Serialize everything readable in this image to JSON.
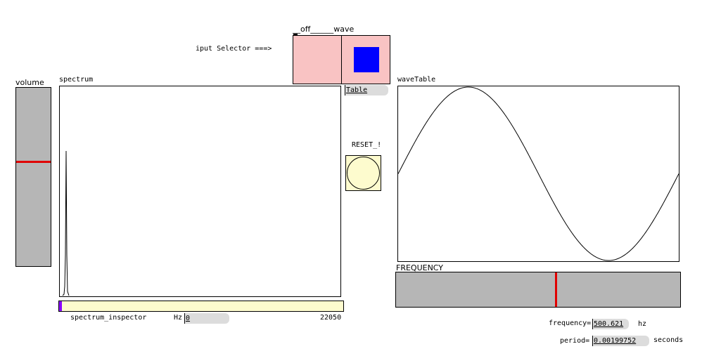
{
  "input_selector": {
    "title": "__off______wave",
    "label": "iput Selector ===>",
    "value_label": "Table",
    "off_color": "#f9c3c3",
    "marker_color": "#0000ff"
  },
  "volume": {
    "label": "volume",
    "level": 0.415,
    "color": "#b6b6b6",
    "indicator_color": "#e00000"
  },
  "spectrum": {
    "label": "spectrum",
    "inspector_label": "spectrum_inspector",
    "hz_label": "Hz",
    "hz_value": "0",
    "max_value": "22050",
    "inspector_color": "#fdfbce",
    "inspector_marker_color": "#8a00ff"
  },
  "reset": {
    "label": "RESET_!",
    "color": "#fdfbce"
  },
  "wavetable": {
    "label": "waveTable"
  },
  "frequency": {
    "label": "FREQUENCY",
    "level": 0.56,
    "freq_label": "frequency=",
    "freq_value": "500.621",
    "freq_unit": "hz",
    "period_label": "period=",
    "period_value": "0.00199752",
    "period_unit": "seconds"
  }
}
